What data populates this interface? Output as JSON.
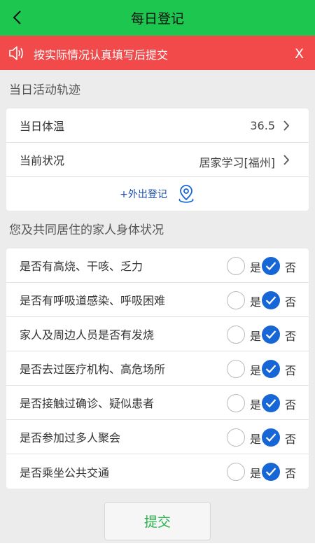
{
  "header": {
    "title": "每日登记"
  },
  "notice": {
    "text": "按实际情况认真填写后提交",
    "close": "X"
  },
  "activity": {
    "section_title": "当日活动轨迹",
    "temperature": {
      "label": "当日体温",
      "value": "36.5"
    },
    "status": {
      "label": "当前状况",
      "value": "居家学习[福州]"
    },
    "outing_link": "+外出登记"
  },
  "health": {
    "section_title": "您及共同居住的家人身体状况",
    "yes_label": "是",
    "no_label": "否",
    "questions": [
      {
        "text": "是否有高烧、干咳、乏力",
        "answer": "否"
      },
      {
        "text": "是否有呼吸道感染、呼吸困难",
        "answer": "否"
      },
      {
        "text": "家人及周边人员是否有发烧",
        "answer": "否"
      },
      {
        "text": "是否去过医疗机构、高危场所",
        "answer": "否"
      },
      {
        "text": "是否接触过确诊、疑似患者",
        "answer": "否"
      },
      {
        "text": "是否参加过多人聚会",
        "answer": "否"
      },
      {
        "text": "是否乘坐公共交通",
        "answer": "否"
      }
    ]
  },
  "submit_label": "提交",
  "colors": {
    "header_bg": "#1dc64f",
    "notice_bg": "#f24a4a",
    "radio_checked": "#1766d6",
    "submit_text": "#2bb24c",
    "link": "#1a4fb0"
  },
  "icons": {
    "back": "chevron-left-icon",
    "notice": "speaker-icon",
    "row_arrow": "chevron-right-icon",
    "outing": "location-pin-icon",
    "checked": "check-icon"
  }
}
